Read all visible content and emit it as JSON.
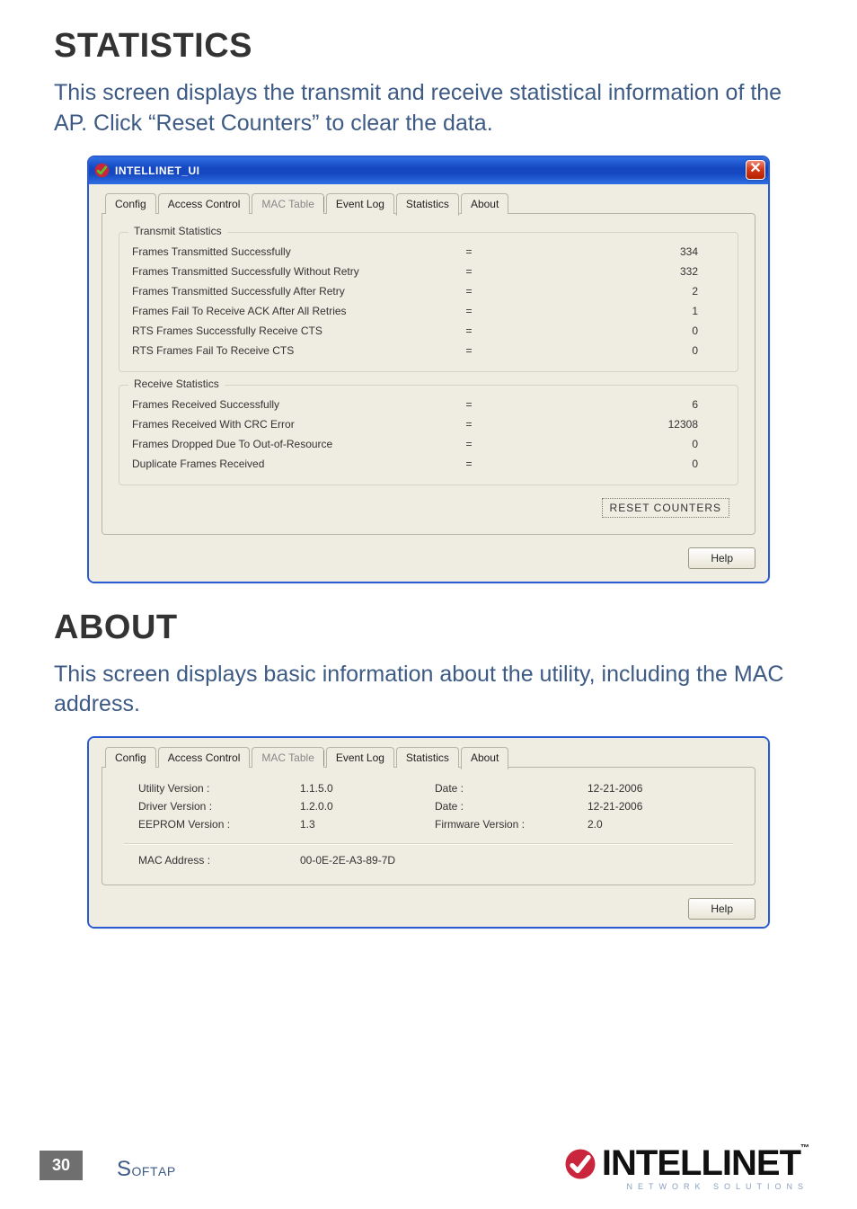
{
  "sections": {
    "statistics": {
      "heading": "STATISTICS",
      "description": "This screen displays the transmit and receive statistical information of the AP. Click “Reset Counters” to clear the data."
    },
    "about": {
      "heading": "ABOUT",
      "description": "This screen displays basic information about the utility, including the MAC address."
    }
  },
  "window": {
    "title": "INTELLINET_UI"
  },
  "tabs": [
    "Config",
    "Access Control",
    "MAC Table",
    "Event Log",
    "Statistics",
    "About"
  ],
  "stats_window": {
    "active_tab": "Statistics",
    "groups": {
      "transmit": {
        "legend": "Transmit Statistics",
        "rows": [
          {
            "label": "Frames Transmitted Successfully",
            "value": "334"
          },
          {
            "label": "Frames Transmitted Successfully  Without Retry",
            "value": "332"
          },
          {
            "label": "Frames Transmitted Successfully After Retry",
            "value": "2"
          },
          {
            "label": "Frames Fail To Receive ACK After All Retries",
            "value": "1"
          },
          {
            "label": "RTS Frames Successfully Receive CTS",
            "value": "0"
          },
          {
            "label": "RTS Frames Fail To Receive CTS",
            "value": "0"
          }
        ]
      },
      "receive": {
        "legend": "Receive Statistics",
        "rows": [
          {
            "label": "Frames Received Successfully",
            "value": "6"
          },
          {
            "label": "Frames Received With CRC Error",
            "value": "12308"
          },
          {
            "label": "Frames Dropped Due To Out-of-Resource",
            "value": "0"
          },
          {
            "label": "Duplicate Frames Received",
            "value": "0"
          }
        ]
      }
    },
    "reset_button": "RESET COUNTERS",
    "help_button": "Help"
  },
  "about_window": {
    "active_tab": "About",
    "fields": {
      "utility_version_label": "Utility Version :",
      "utility_version_value": "1.1.5.0",
      "utility_date_label": "Date :",
      "utility_date_value": "12-21-2006",
      "driver_version_label": "Driver Version :",
      "driver_version_value": "1.2.0.0",
      "driver_date_label": "Date :",
      "driver_date_value": "12-21-2006",
      "eeprom_version_label": "EEPROM Version :",
      "eeprom_version_value": "1.3",
      "firmware_version_label": "Firmware Version :",
      "firmware_version_value": "2.0",
      "mac_label": "MAC Address :",
      "mac_value": "00-0E-2E-A3-89-7D"
    },
    "help_button": "Help"
  },
  "footer": {
    "page_number": "30",
    "section_label": "SoftAP",
    "brand_name": "INTELLINET",
    "brand_tagline": "NETWORK SOLUTIONS"
  }
}
